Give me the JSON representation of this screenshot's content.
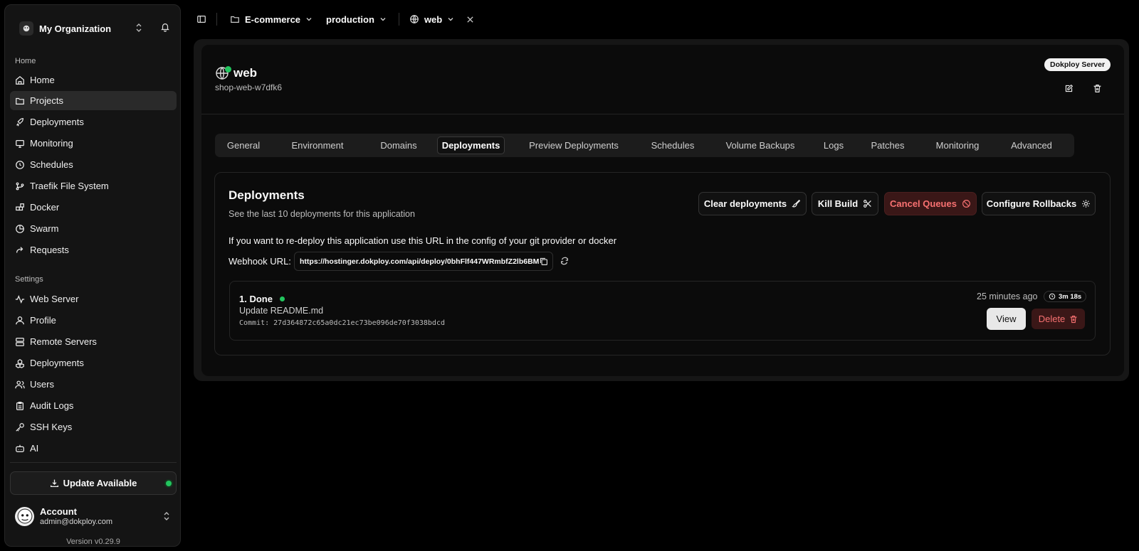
{
  "sidebar": {
    "org_name": "My Organization",
    "home_section": "Home",
    "items": [
      {
        "label": "Home",
        "icon": "house-icon"
      },
      {
        "label": "Projects",
        "icon": "folder-icon"
      },
      {
        "label": "Deployments",
        "icon": "rocket-icon"
      },
      {
        "label": "Monitoring",
        "icon": "activity-icon"
      },
      {
        "label": "Schedules",
        "icon": "clock-icon"
      },
      {
        "label": "Traefik File System",
        "icon": "git-icon"
      },
      {
        "label": "Docker",
        "icon": "blocks-icon"
      },
      {
        "label": "Swarm",
        "icon": "pie-icon"
      },
      {
        "label": "Requests",
        "icon": "forward-icon"
      }
    ],
    "settings_section": "Settings",
    "settings_items": [
      {
        "label": "Web Server",
        "icon": "activity-icon"
      },
      {
        "label": "Profile",
        "icon": "user-icon"
      },
      {
        "label": "Remote Servers",
        "icon": "server-icon"
      },
      {
        "label": "Deployments",
        "icon": "boxes-icon"
      },
      {
        "label": "Users",
        "icon": "users-icon"
      },
      {
        "label": "Audit Logs",
        "icon": "clipboard-icon"
      },
      {
        "label": "SSH Keys",
        "icon": "key-icon"
      },
      {
        "label": "AI",
        "icon": "bot-icon"
      }
    ],
    "update_label": "Update Available",
    "account": {
      "name": "Account",
      "email": "admin@dokploy.com"
    },
    "version": "Version v0.29.9"
  },
  "topbar": {
    "project": "E-commerce",
    "environment": "production",
    "service": "web"
  },
  "app": {
    "name": "web",
    "app_id": "shop-web-w7dfk6",
    "server_badge": "Dokploy Server"
  },
  "tabs": [
    "General",
    "Environment",
    "Domains",
    "Deployments",
    "Preview Deployments",
    "Schedules",
    "Volume Backups",
    "Logs",
    "Patches",
    "Monitoring",
    "Advanced"
  ],
  "active_tab": "Deployments",
  "deployments_card": {
    "title": "Deployments",
    "description": "See the last 10 deployments for this application",
    "buttons": {
      "clear": "Clear deployments",
      "kill": "Kill Build",
      "cancel": "Cancel Queues",
      "configure": "Configure Rollbacks"
    },
    "redeploy_note": "If you want to re-deploy this application use this URL in the config of your git provider or docker",
    "webhook_label": "Webhook URL:",
    "webhook_url": "https://hostinger.dokploy.com/api/deploy/0bhFlf447WRmbfZ2lb6BM",
    "entries": [
      {
        "status": "1. Done",
        "message": "Update README.md",
        "commit": "Commit: 27d364872c65a0dc21ec73be096de70f3038bdcd",
        "time_ago": "25 minutes ago",
        "duration": "3m 18s",
        "view_label": "View",
        "delete_label": "Delete"
      }
    ]
  },
  "colors": {
    "success": "#22c55e",
    "danger": "#f87171",
    "background": "#000000"
  }
}
